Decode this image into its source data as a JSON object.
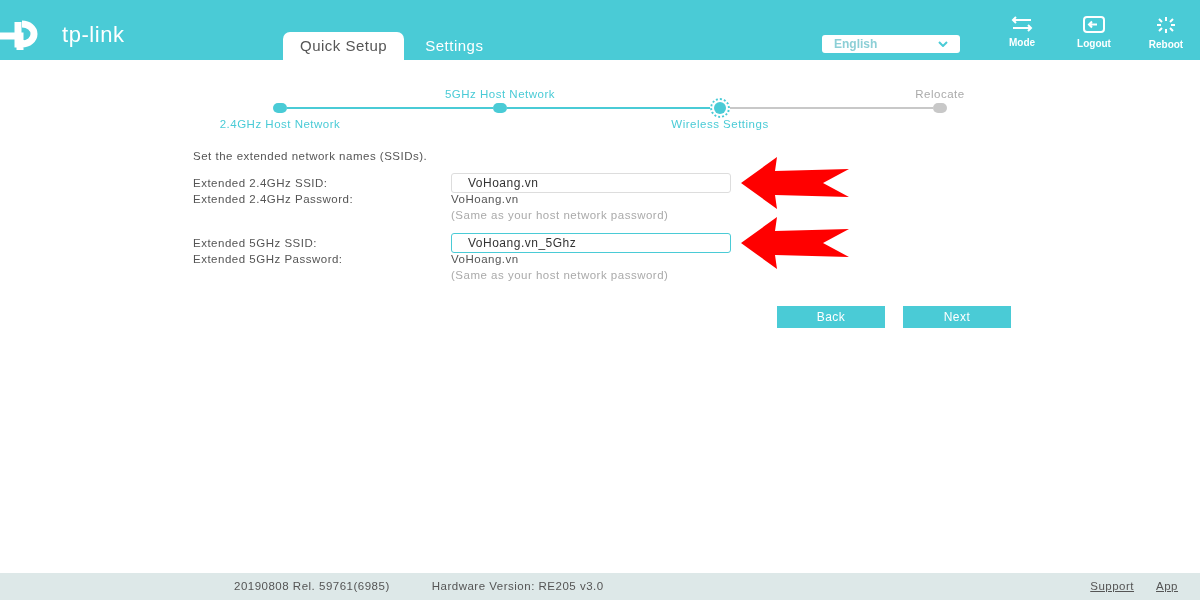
{
  "header": {
    "logo_text": "tp-link",
    "tabs": [
      {
        "label": "Quick Setup",
        "selected": true
      },
      {
        "label": "Settings",
        "selected": false
      }
    ],
    "language": {
      "value": "English"
    },
    "actions": [
      {
        "kind": "mode",
        "label": "Mode"
      },
      {
        "kind": "logout",
        "label": "Logout"
      },
      {
        "kind": "reboot",
        "label": "Reboot"
      }
    ]
  },
  "stepper": [
    {
      "label": "2.4GHz Host Network",
      "done": true,
      "current": false
    },
    {
      "label": "5GHz Host Network",
      "done": true,
      "current": false
    },
    {
      "label": "Wireless Settings",
      "done": false,
      "current": true
    },
    {
      "label": "Relocate",
      "done": false,
      "current": false
    }
  ],
  "intro": "Set the extended network names (SSIDs).",
  "groups": [
    {
      "ssid_label": "Extended 2.4GHz SSID:",
      "ssid_value": "VoHoang.vn",
      "focused": false,
      "password_label": "Extended 2.4GHz Password:",
      "password_value": "VoHoang.vn",
      "password_note": "(Same as your host network password)"
    },
    {
      "ssid_label": "Extended 5GHz SSID:",
      "ssid_value": "VoHoang.vn_5Ghz",
      "focused": true,
      "password_label": "Extended 5GHz Password:",
      "password_value": "VoHoang.vn",
      "password_note": "(Same as your host network password)"
    }
  ],
  "buttons": [
    "Back",
    "Next"
  ],
  "footer": {
    "firmware": "20190808 Rel. 59761(6985)",
    "hardware": "Hardware Version: RE205 v3.0",
    "links": [
      "Support",
      "App"
    ]
  }
}
